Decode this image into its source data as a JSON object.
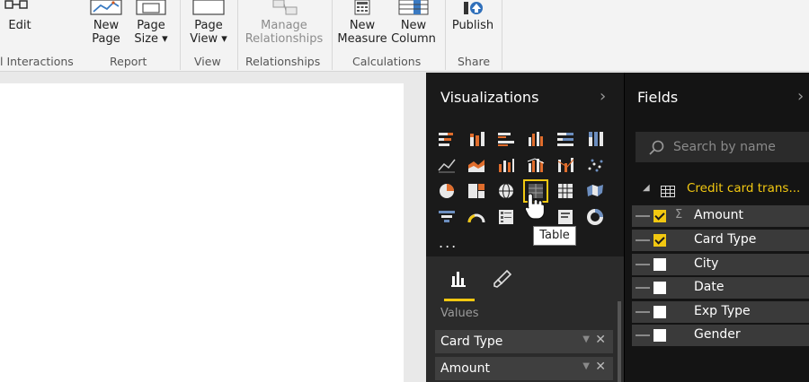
{
  "ribbon": {
    "buttons": [
      {
        "label1": "Edit",
        "label2": "",
        "icon": "edit-interactions-icon"
      },
      {
        "label1": "New",
        "label2": "Page",
        "icon": "new-page-icon"
      },
      {
        "label1": "Page",
        "label2": "Size ▾",
        "icon": "page-size-icon"
      },
      {
        "label1": "Page",
        "label2": "View ▾",
        "icon": "page-view-icon"
      },
      {
        "label1": "Manage",
        "label2": "Relationships",
        "icon": "manage-relationships-icon"
      },
      {
        "label1": "New",
        "label2": "Measure",
        "icon": "new-measure-icon"
      },
      {
        "label1": "New",
        "label2": "Column",
        "icon": "new-column-icon"
      },
      {
        "label1": "Publish",
        "label2": "",
        "icon": "publish-icon"
      }
    ],
    "groups": [
      "l Interactions",
      "Report",
      "View",
      "Relationships",
      "Calculations",
      "Share"
    ]
  },
  "visualizations": {
    "title": "Visualizations",
    "tooltip": "Table",
    "ellipsis": "...",
    "values_label": "Values",
    "wells": [
      "Card Type",
      "Amount"
    ],
    "tabs": [
      "fields-tab-icon",
      "format-paintbrush-icon"
    ]
  },
  "fields": {
    "title": "Fields",
    "search_placeholder": "Search by name",
    "table_name": "Credit card trans...",
    "items": [
      {
        "name": "Amount",
        "checked": true,
        "sigma": "Σ"
      },
      {
        "name": "Card Type",
        "checked": true,
        "sigma": ""
      },
      {
        "name": "City",
        "checked": false,
        "sigma": ""
      },
      {
        "name": "Date",
        "checked": false,
        "sigma": ""
      },
      {
        "name": "Exp Type",
        "checked": false,
        "sigma": ""
      },
      {
        "name": "Gender",
        "checked": false,
        "sigma": ""
      }
    ]
  },
  "colors": {
    "accent": "#f2c811",
    "dark_pane": "#1a1a1a",
    "fields_pane": "#141414"
  }
}
